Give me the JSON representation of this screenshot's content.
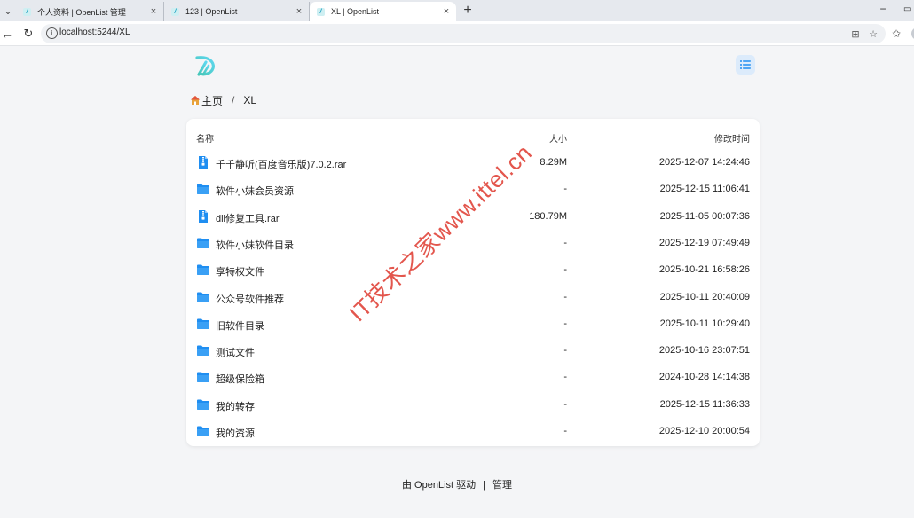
{
  "browser": {
    "tabs": [
      {
        "title": "个人资料 | OpenList 管理",
        "active": false
      },
      {
        "title": "123 | OpenList",
        "active": false
      },
      {
        "title": "XL | OpenList",
        "active": true
      }
    ],
    "new_tab_label": "+",
    "url": "localhost:5244/XL"
  },
  "header": {
    "logo_icon": "openlist-logo-icon",
    "menu_icon": "list-menu-icon",
    "accent_color": "#1f8ef1"
  },
  "breadcrumb": {
    "home_label": "主页",
    "separator": "/",
    "current": "XL"
  },
  "file_list": {
    "columns": {
      "name": "名称",
      "size": "大小",
      "modified": "修改时间"
    },
    "rows": [
      {
        "type": "archive",
        "name": "千千静听(百度音乐版)7.0.2.rar",
        "size": "8.29M",
        "modified": "2025-12-07 14:24:46"
      },
      {
        "type": "folder",
        "name": "软件小妹会员资源",
        "size": "-",
        "modified": "2025-12-15 11:06:41"
      },
      {
        "type": "archive",
        "name": "dll修复工具.rar",
        "size": "180.79M",
        "modified": "2025-11-05 00:07:36"
      },
      {
        "type": "folder",
        "name": "软件小妹软件目录",
        "size": "-",
        "modified": "2025-12-19 07:49:49"
      },
      {
        "type": "folder",
        "name": "享特权文件",
        "size": "-",
        "modified": "2025-10-21 16:58:26"
      },
      {
        "type": "folder",
        "name": "公众号软件推荐",
        "size": "-",
        "modified": "2025-10-11 20:40:09"
      },
      {
        "type": "folder",
        "name": "旧软件目录",
        "size": "-",
        "modified": "2025-10-11 10:29:40"
      },
      {
        "type": "folder",
        "name": "测试文件",
        "size": "-",
        "modified": "2025-10-16 23:07:51"
      },
      {
        "type": "folder",
        "name": "超级保险箱",
        "size": "-",
        "modified": "2024-10-28 14:14:38"
      },
      {
        "type": "folder",
        "name": "我的转存",
        "size": "-",
        "modified": "2025-12-15 11:36:33"
      },
      {
        "type": "folder",
        "name": "我的资源",
        "size": "-",
        "modified": "2025-12-10 20:00:54"
      }
    ]
  },
  "footer": {
    "powered_by": "由 OpenList 驱动",
    "separator": "|",
    "manage_label": "管理"
  },
  "watermark": "IT技术之家www.ittel.cn"
}
